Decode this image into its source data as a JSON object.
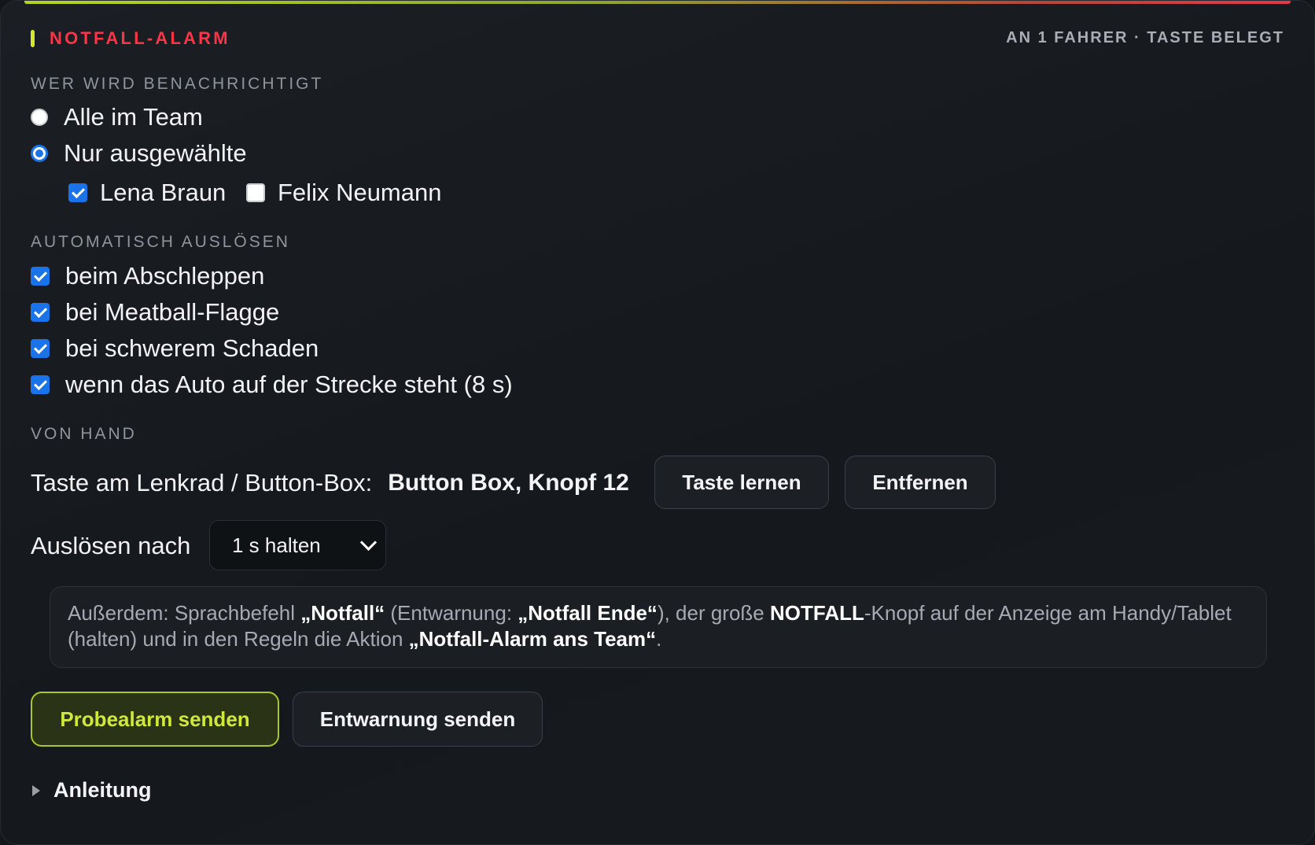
{
  "header": {
    "title": "NOTFALL-ALARM",
    "status": "AN 1 FAHRER · TASTE BELEGT"
  },
  "recipients": {
    "section_label": "WER WIRD BENACHRICHTIGT",
    "options": [
      {
        "label": "Alle im Team",
        "selected": false
      },
      {
        "label": "Nur ausgewählte",
        "selected": true
      }
    ],
    "people": [
      {
        "label": "Lena Braun",
        "checked": true
      },
      {
        "label": "Felix Neumann",
        "checked": false
      }
    ]
  },
  "auto": {
    "section_label": "AUTOMATISCH AUSLÖSEN",
    "items": [
      {
        "label": "beim Abschleppen",
        "checked": true
      },
      {
        "label": "bei Meatball-Flagge",
        "checked": true
      },
      {
        "label": "bei schwerem Schaden",
        "checked": true
      },
      {
        "label": "wenn das Auto auf der Strecke steht (8 s)",
        "checked": true
      }
    ]
  },
  "manual": {
    "section_label": "VON HAND",
    "key_label": "Taste am Lenkrad / Button-Box:",
    "key_value": "Button Box, Knopf 12",
    "learn_button": "Taste lernen",
    "remove_button": "Entfernen",
    "trigger_label": "Auslösen nach",
    "trigger_value": "1 s halten"
  },
  "info": {
    "t1": "Außerdem: Sprachbefehl ",
    "b1": "„Notfall“",
    "t2": " (Entwarnung: ",
    "b2": "„Notfall Ende“",
    "t3": "), der große ",
    "b3": "NOTFALL",
    "t4": "-Knopf auf der Anzeige am Handy/Tablet (halten) und in den Regeln die Aktion ",
    "b4": "„Notfall-Alarm ans Team“",
    "t5": "."
  },
  "actions": {
    "test_button": "Probealarm senden",
    "clear_button": "Entwarnung senden"
  },
  "help": {
    "label": "Anleitung"
  },
  "colors": {
    "alert_red": "#ff3446",
    "accent_lime": "#cfe83a",
    "checkbox_blue": "#1a73e8"
  }
}
